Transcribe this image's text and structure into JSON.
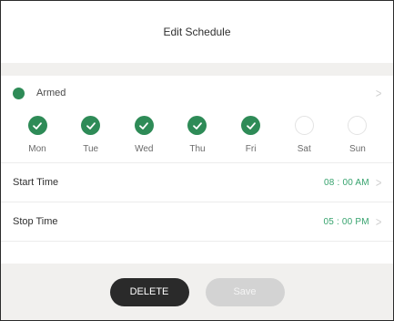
{
  "header": {
    "title": "Edit Schedule"
  },
  "status": {
    "label": "Armed",
    "color": "#2e8b57"
  },
  "days": [
    {
      "label": "Mon",
      "selected": true
    },
    {
      "label": "Tue",
      "selected": true
    },
    {
      "label": "Wed",
      "selected": true
    },
    {
      "label": "Thu",
      "selected": true
    },
    {
      "label": "Fri",
      "selected": true
    },
    {
      "label": "Sat",
      "selected": false
    },
    {
      "label": "Sun",
      "selected": false
    }
  ],
  "start_time": {
    "label": "Start Time",
    "value": "08 : 00 AM"
  },
  "stop_time": {
    "label": "Stop Time",
    "value": "05 : 00 PM"
  },
  "buttons": {
    "delete_label": "DELETE",
    "save_label": "Save"
  },
  "colors": {
    "accent": "#2e8b57",
    "time_text": "#37a36e",
    "band": "#f1f0ee",
    "delete_bg": "#2a2a2a",
    "save_bg_disabled": "#d3d3d3"
  }
}
